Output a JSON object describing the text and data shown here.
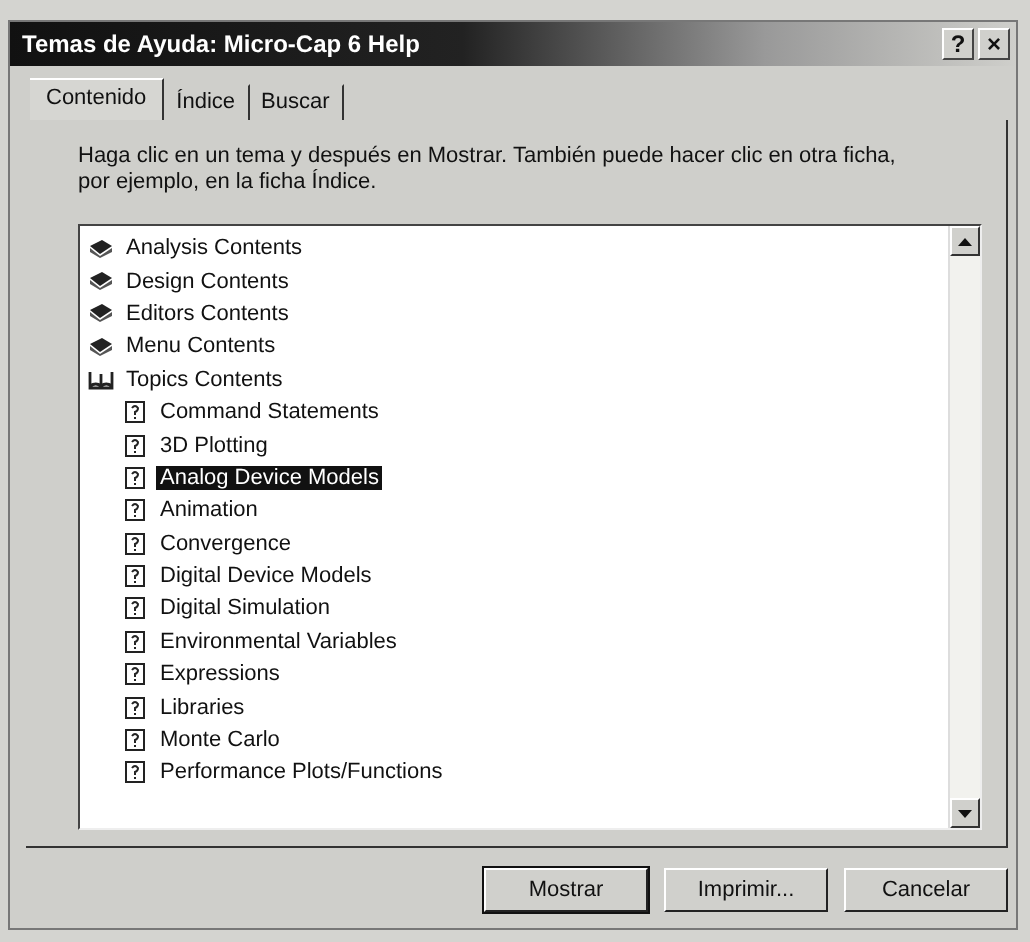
{
  "window": {
    "title": "Temas de Ayuda: Micro-Cap 6 Help",
    "help_button": "?",
    "close_button": "×"
  },
  "tabs": [
    {
      "label": "Contenido",
      "selected": true
    },
    {
      "label": "Índice",
      "selected": false
    },
    {
      "label": "Buscar",
      "selected": false
    }
  ],
  "instructions": "Haga clic en un tema y después en Mostrar. También puede hacer clic en otra ficha, por ejemplo, en la ficha Índice.",
  "tree": [
    {
      "kind": "book",
      "label": "Analysis Contents",
      "selected": false
    },
    {
      "kind": "book",
      "label": "Design Contents",
      "selected": false
    },
    {
      "kind": "book",
      "label": "Editors Contents",
      "selected": false
    },
    {
      "kind": "book",
      "label": "Menu Contents",
      "selected": false
    },
    {
      "kind": "open-book",
      "label": "Topics Contents",
      "selected": false,
      "children": [
        {
          "kind": "topic",
          "label": "Command Statements",
          "selected": false
        },
        {
          "kind": "topic",
          "label": "3D Plotting",
          "selected": false
        },
        {
          "kind": "topic",
          "label": "Analog Device Models",
          "selected": true
        },
        {
          "kind": "topic",
          "label": "Animation",
          "selected": false
        },
        {
          "kind": "topic",
          "label": "Convergence",
          "selected": false
        },
        {
          "kind": "topic",
          "label": "Digital Device Models",
          "selected": false
        },
        {
          "kind": "topic",
          "label": "Digital Simulation",
          "selected": false
        },
        {
          "kind": "topic",
          "label": "Environmental Variables",
          "selected": false
        },
        {
          "kind": "topic",
          "label": "Expressions",
          "selected": false
        },
        {
          "kind": "topic",
          "label": "Libraries",
          "selected": false
        },
        {
          "kind": "topic",
          "label": "Monte Carlo",
          "selected": false
        },
        {
          "kind": "topic",
          "label": "Performance Plots/Functions",
          "selected": false
        }
      ]
    }
  ],
  "buttons": [
    "Mostrar",
    "Imprimir...",
    "Cancelar"
  ]
}
